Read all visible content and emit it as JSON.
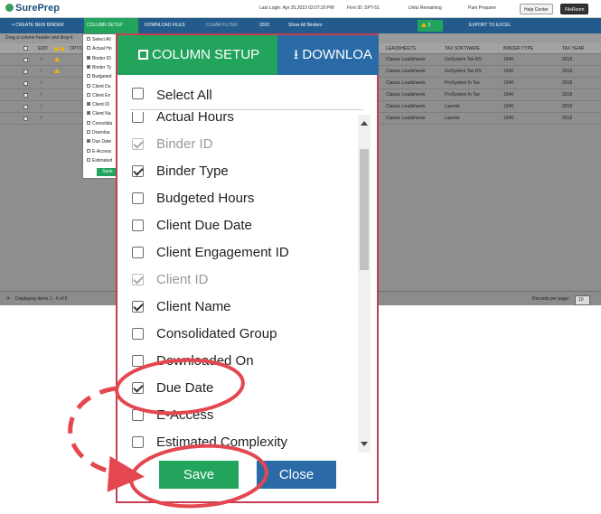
{
  "header": {
    "brand": "SurePrep",
    "last_login": "Last Login: Apr 25,2019 02:07:20 PM",
    "firm_id": "Firm ID: SPT-51",
    "units": "Units Remaining",
    "user": "Pam Preparer",
    "help": "Help Center",
    "fileroom": "FileRoom"
  },
  "toolbar": {
    "create": "+ CREATE NEW BINDER",
    "column_setup": "COLUMN SETUP",
    "download": "DOWNLOAD FILES",
    "clear_filter": "CLEAR FILTER",
    "year": "2020",
    "show_all": "Show All Binders",
    "badge_count": "3",
    "export": "EXPORT TO EXCEL"
  },
  "grid": {
    "drag_hint": "Drag a column header and drop it",
    "headers": {
      "edit": "EDIT",
      "options": "OPTIO",
      "leadsheets": "LEADSHEETS",
      "tax_software": "TAX SOFTWARE",
      "binder_type": "BINDER TYPE",
      "tax_year": "TAX YEAR"
    },
    "rows": [
      {
        "leadsheets": "Classic Leadsheets",
        "tax_software": "GoSystem Tax RS",
        "binder_type": "1040",
        "tax_year": "2018"
      },
      {
        "leadsheets": "Classic Leadsheets",
        "tax_software": "GoSystem Tax RS",
        "binder_type": "1040",
        "tax_year": "2018"
      },
      {
        "leadsheets": "Classic Leadsheets",
        "tax_software": "ProSystem fx Tax",
        "binder_type": "1040",
        "tax_year": "2018"
      },
      {
        "leadsheets": "Classic Leadsheets",
        "tax_software": "ProSystem fx Tax",
        "binder_type": "1040",
        "tax_year": "2018"
      },
      {
        "leadsheets": "Classic Leadsheets",
        "tax_software": "Lacerte",
        "binder_type": "1040",
        "tax_year": "2018"
      },
      {
        "leadsheets": "Classic Leadsheets",
        "tax_software": "Lacerte",
        "binder_type": "1040",
        "tax_year": "2018"
      }
    ],
    "status": "Displaying items 1 - 6 of 6",
    "records_label": "Records per page:",
    "records_value": "10"
  },
  "small_popup": {
    "items": [
      "Select All",
      "Actual Ho",
      "Binder ID",
      "Binder Ty",
      "Budgeted",
      "Client Du",
      "Client En",
      "Client ID",
      "Client Na",
      "Consolida",
      "Downloa",
      "Due Date",
      "E-Access",
      "Estimated"
    ],
    "save": "Save"
  },
  "modal": {
    "tab_column_setup": "COLUMN SETUP",
    "tab_download": "DOWNLOA",
    "select_all": "Select All",
    "items": [
      {
        "label": "Actual Hours",
        "checked": false,
        "disabled": false
      },
      {
        "label": "Binder ID",
        "checked": true,
        "disabled": true
      },
      {
        "label": "Binder Type",
        "checked": true,
        "disabled": false
      },
      {
        "label": "Budgeted Hours",
        "checked": false,
        "disabled": false
      },
      {
        "label": "Client Due Date",
        "checked": false,
        "disabled": false
      },
      {
        "label": "Client Engagement ID",
        "checked": false,
        "disabled": false
      },
      {
        "label": "Client ID",
        "checked": true,
        "disabled": true
      },
      {
        "label": "Client Name",
        "checked": true,
        "disabled": false
      },
      {
        "label": "Consolidated Group",
        "checked": false,
        "disabled": false
      },
      {
        "label": "Downloaded On",
        "checked": false,
        "disabled": false
      },
      {
        "label": "Due Date",
        "checked": true,
        "disabled": false
      },
      {
        "label": "E-Access",
        "checked": false,
        "disabled": false
      },
      {
        "label": "Estimated Complexity",
        "checked": false,
        "disabled": false
      }
    ],
    "save": "Save",
    "close": "Close"
  },
  "colors": {
    "green": "#22a45d",
    "blue": "#2a6aa6",
    "navy": "#225b8c",
    "annotation_red": "#e4474f"
  }
}
